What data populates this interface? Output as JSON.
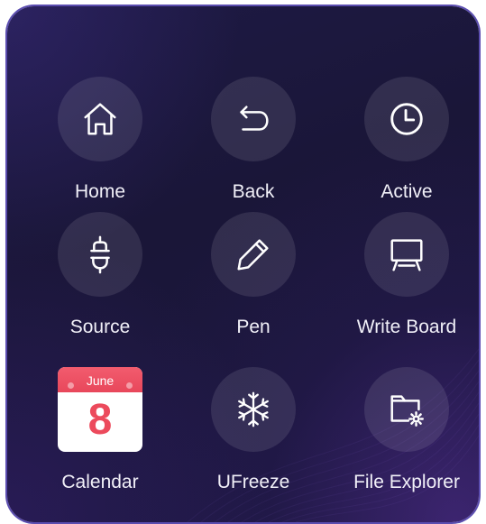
{
  "launcher": {
    "items": [
      {
        "label": "Home",
        "icon": "home-icon"
      },
      {
        "label": "Back",
        "icon": "back-arrow-icon"
      },
      {
        "label": "Active",
        "icon": "clock-icon"
      },
      {
        "label": "Source",
        "icon": "plug-icon"
      },
      {
        "label": "Pen",
        "icon": "pen-icon"
      },
      {
        "label": "Write Board",
        "icon": "whiteboard-icon"
      },
      {
        "label": "Calendar",
        "icon": "calendar-icon"
      },
      {
        "label": "UFreeze",
        "icon": "snowflake-icon"
      },
      {
        "label": "File Explorer",
        "icon": "folder-gear-icon"
      }
    ],
    "calendar": {
      "month": "June",
      "day": "8"
    }
  },
  "colors": {
    "panel_background": "#1c1840",
    "icon_circle": "rgba(255,255,255,0.10)",
    "label_text": "#f1f0f8",
    "calendar_accent": "#ec4a5c",
    "frame_border": "#5b4db0"
  }
}
